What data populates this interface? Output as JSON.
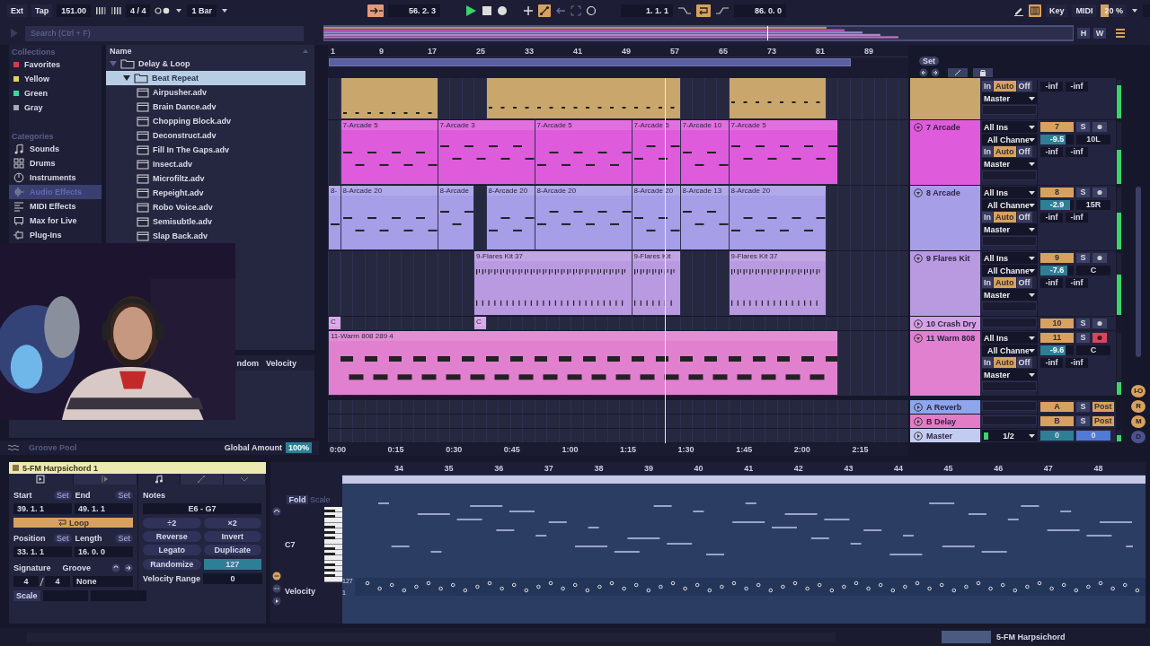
{
  "transport": {
    "sync": "Ext",
    "tap": "Tap",
    "tempo": "151.00",
    "signature": "4 / 4",
    "quantization": "1 Bar",
    "follow": {
      "on": true
    },
    "position": "56. 2. 3",
    "automation_arm": {
      "on": true
    },
    "loop_start": "1. 1. 1",
    "loop": {
      "on": true
    },
    "loop_length": "86. 0. 0",
    "computer_keys": {
      "on": true
    },
    "key_map": "Key",
    "midi_map": "MIDI",
    "cpu": {
      "reading": "20 %",
      "level": 0.3
    }
  },
  "overview_buttons": [
    "H",
    "W"
  ],
  "browser": {
    "search_placeholder": "Search (Ctrl + F)",
    "collections_title": "Collections",
    "collections": [
      {
        "label": "Favorites",
        "color": "#e0364f"
      },
      {
        "label": "Yellow",
        "color": "#e3d55a"
      },
      {
        "label": "Green",
        "color": "#3fd6a5"
      },
      {
        "label": "Gray",
        "color": "#a9a9b6"
      }
    ],
    "categories_title": "Categories",
    "categories": [
      {
        "label": "Sounds",
        "kind": "sounds",
        "selected": false
      },
      {
        "label": "Drums",
        "kind": "drums",
        "selected": false
      },
      {
        "label": "Instruments",
        "kind": "instruments",
        "selected": false
      },
      {
        "label": "Audio Effects",
        "kind": "audio",
        "selected": true
      },
      {
        "label": "MIDI Effects",
        "kind": "midi",
        "selected": false
      },
      {
        "label": "Max for Live",
        "kind": "max",
        "selected": false
      },
      {
        "label": "Plug-Ins",
        "kind": "plugins",
        "selected": false
      }
    ],
    "name_header": "Name",
    "tree": [
      {
        "label": "Delay & Loop",
        "expanded": true,
        "selected": false,
        "children": [
          {
            "label": "Beat Repeat",
            "expanded": true,
            "selected": true,
            "children": [
              {
                "label": "Airpusher.adv",
                "selected": false
              },
              {
                "label": "Brain Dance.adv",
                "selected": false
              },
              {
                "label": "Chopping Block.adv",
                "selected": false
              },
              {
                "label": "Deconstruct.adv",
                "selected": false
              },
              {
                "label": "Fill In The Gaps.adv",
                "selected": false
              },
              {
                "label": "Insect.adv",
                "selected": false
              },
              {
                "label": "Microfiltz.adv",
                "selected": false
              },
              {
                "label": "Repeight.adv",
                "selected": false
              },
              {
                "label": "Robo Voice.adv",
                "selected": false
              },
              {
                "label": "Semisubtle.adv",
                "selected": false
              },
              {
                "label": "Slap Back.adv",
                "selected": false
              }
            ]
          }
        ]
      }
    ],
    "groove_columns": [
      "ndom",
      "Velocity"
    ],
    "groove_title": "Groove Pool",
    "global_amount_label": "Global Amount",
    "global_amount": "100%"
  },
  "webcam": {
    "kind": "picture"
  },
  "arrangement": {
    "bars": [
      "1",
      "9",
      "17",
      "25",
      "33",
      "41",
      "49",
      "57",
      "65",
      "73",
      "81",
      "89"
    ],
    "times": [
      "0:00",
      "0:15",
      "0:30",
      "0:45",
      "1:00",
      "1:15",
      "1:30",
      "1:45",
      "2:00",
      "2:15"
    ],
    "set_button": "Set",
    "tracks": [
      {
        "color": "#c8a66c",
        "mixer": {
          "monitor": [
            {
              "label": "In",
              "selected": false
            },
            {
              "label": "Auto",
              "selected": true
            },
            {
              "label": "Off",
              "selected": false
            }
          ],
          "output": "Master",
          "readings": [
            "-inf",
            "-inf"
          ],
          "meter": {
            "level": 0.85
          }
        }
      },
      {
        "name": "7 Arcade",
        "color": "#de5cdc",
        "expanded": true,
        "clips": [
          {
            "name": "7-Arcade 5"
          },
          {
            "name": "7-Arcade 3"
          },
          {
            "name": "7-Arcade 5"
          },
          {
            "name": "7-Arcade 5"
          },
          {
            "name": "7-Arcade 10"
          },
          {
            "name": "7-Arcade 5"
          }
        ],
        "mixer": {
          "input": "All Ins",
          "channel": "All Channe",
          "monitor": [
            {
              "label": "In",
              "selected": false
            },
            {
              "label": "Auto",
              "selected": true
            },
            {
              "label": "Off",
              "selected": false
            }
          ],
          "output": "Master",
          "number": "7",
          "solo": "S",
          "armed": false,
          "volume": {
            "reading": "-9.5",
            "level": 0.75
          },
          "pan": "10L",
          "readings": [
            "-inf",
            "-inf"
          ],
          "meter": {
            "level": 0.55
          }
        }
      },
      {
        "name": "8 Arcade",
        "color": "#a79ee8",
        "expanded": true,
        "clips": [
          {
            "name": "8-"
          },
          {
            "name": "8-Arcade 20"
          },
          {
            "name": "8-Arcade"
          },
          {
            "name": "8-Arcade 20"
          },
          {
            "name": "8-Arcade 20"
          },
          {
            "name": "8-Arcade 20"
          },
          {
            "name": "8-Arcade 13"
          },
          {
            "name": "8-Arcade 20"
          }
        ],
        "mixer": {
          "input": "All Ins",
          "channel": "All Channe",
          "monitor": [
            {
              "label": "In",
              "selected": false
            },
            {
              "label": "Auto",
              "selected": true
            },
            {
              "label": "Off",
              "selected": false
            }
          ],
          "output": "Master",
          "number": "8",
          "solo": "S",
          "armed": false,
          "volume": {
            "reading": "-2.9",
            "level": 0.9
          },
          "pan": "15R",
          "readings": [
            "-inf",
            "-inf"
          ],
          "meter": {
            "level": 0.6
          }
        }
      },
      {
        "name": "9 Flares Kit",
        "color": "#b99ae0",
        "expanded": true,
        "clips": [
          {
            "name": "9-Flares Kit 37"
          },
          {
            "name": "9-Flares Kit"
          },
          {
            "name": "9-Flares Kit 37"
          }
        ],
        "mixer": {
          "input": "All Ins",
          "channel": "All Channe",
          "monitor": [
            {
              "label": "In",
              "selected": false
            },
            {
              "label": "Auto",
              "selected": true
            },
            {
              "label": "Off",
              "selected": false
            }
          ],
          "output": "Master",
          "number": "9",
          "solo": "S",
          "armed": false,
          "volume": {
            "reading": "-7.6",
            "level": 0.8
          },
          "pan": "C",
          "readings": [
            "-inf",
            "-inf"
          ],
          "meter": {
            "level": 0.65
          }
        }
      },
      {
        "name": "10 Crash Dry",
        "color": "#d6a0e6",
        "expanded": false,
        "clips": [
          {
            "name": "C"
          },
          {
            "name": "C"
          }
        ],
        "mixer": {
          "number": "10",
          "solo": "S",
          "armed": false
        }
      },
      {
        "name": "11 Warm 808",
        "color": "#e080cf",
        "expanded": true,
        "clips": [
          {
            "name": "11-Warm 808 289 4"
          }
        ],
        "mixer": {
          "input": "All Ins",
          "channel": "All Channe",
          "monitor": [
            {
              "label": "In",
              "selected": false
            },
            {
              "label": "Auto",
              "selected": true
            },
            {
              "label": "Off",
              "selected": false
            }
          ],
          "output": "Master",
          "number": "11",
          "solo": "S",
          "armed": true,
          "volume": {
            "reading": "-9.6",
            "level": 0.75
          },
          "pan": "C",
          "readings": [
            "-inf",
            "-inf"
          ],
          "meter": {
            "level": 0.2
          }
        }
      }
    ],
    "returns": [
      {
        "name": "A Reverb",
        "color": "#8ea6ec",
        "kind": "return",
        "letter": "A",
        "solo": "S",
        "post": {
          "label": "Post",
          "on": true
        }
      },
      {
        "name": "B Delay",
        "color": "#e27cc6",
        "kind": "return",
        "letter": "B",
        "solo": "S",
        "post": {
          "label": "Post",
          "on": true
        }
      },
      {
        "name": "Master",
        "color": "#c4cbf3",
        "kind": "master",
        "output": "1/2",
        "volume": "0",
        "pan": "0",
        "meter": {
          "level": 0.6
        }
      }
    ],
    "view_buttons": [
      "I-O",
      "R",
      "M",
      "D"
    ]
  },
  "clip": {
    "title": "5-FM Harpsichord 1",
    "clip_tabs": [
      {
        "kind": "clip",
        "selected": true
      },
      {
        "kind": "sample",
        "selected": false
      }
    ],
    "note_tabs": [
      {
        "kind": "notes",
        "selected": true
      },
      {
        "kind": "envelope",
        "selected": false
      },
      {
        "kind": "expand",
        "selected": false
      }
    ],
    "start_label": "Start",
    "end_label": "End",
    "set_labels": [
      "Set",
      "Set",
      "Set",
      "Set"
    ],
    "start": "39. 1. 1",
    "end": "49. 1. 1",
    "loop": {
      "label": "Loop",
      "on": true
    },
    "position_label": "Position",
    "length_label": "Length",
    "position": "33. 1. 1",
    "length": "16. 0. 0",
    "signature_label": "Signature",
    "groove_label": "Groove",
    "signature_numerator": "4",
    "signature_denominator": "4",
    "groove": "None",
    "scale": "Scale",
    "notes_label": "Notes",
    "note_range": "E6 - G7",
    "note_buttons": [
      "÷2",
      "×2",
      "Reverse",
      "Invert",
      "Legato",
      "Duplicate"
    ],
    "randomize": "Randomize",
    "randomize_amount": "127",
    "velocity_range_label": "Velocity Range",
    "velocity_range": "0"
  },
  "piano_roll": {
    "fold": "Fold",
    "scale": "Scale",
    "key_label": "C7",
    "bars": [
      "34",
      "35",
      "36",
      "37",
      "38",
      "39",
      "40",
      "41",
      "42",
      "43",
      "44",
      "45",
      "46",
      "47",
      "48"
    ],
    "velocity_label": "Velocity",
    "velocity_max": "127",
    "velocity_min": "1"
  },
  "status_bar": {
    "track": "5-FM Harpsichord"
  }
}
